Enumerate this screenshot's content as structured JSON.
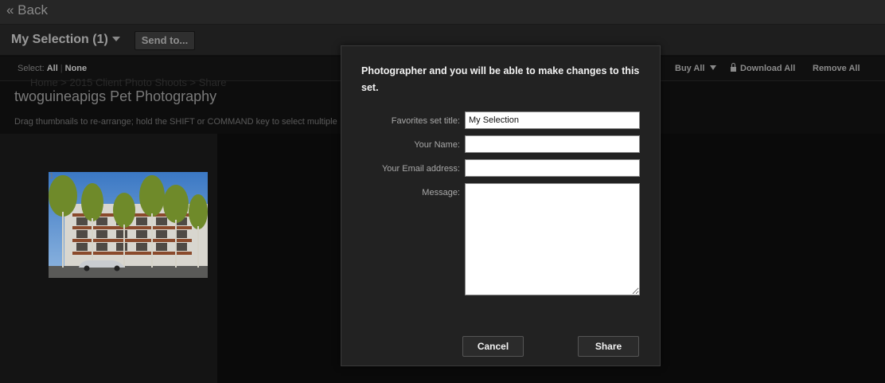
{
  "nav": {
    "back_label": "« Back"
  },
  "selection_bar": {
    "title": "My Selection (1)",
    "send_button_label": "Send to..."
  },
  "toolbar": {
    "select_prefix": "Select:",
    "select_all": "All",
    "select_separator": "|",
    "select_none": "None",
    "buy_all": "Buy All",
    "download_all": "Download All",
    "remove_all": "Remove All"
  },
  "gallery": {
    "breadcrumb": "Home > 2015 Client Photo Shoots > Share",
    "title": "twoguineapigs Pet Photography",
    "hint": "Drag thumbnails to re-arrange; hold the SHIFT or COMMAND key to select multiple",
    "thumbnails": [
      {
        "index": "1"
      }
    ]
  },
  "dialog": {
    "message": "Photographer and you will be able to make changes to this set.",
    "fields": {
      "title_label": "Favorites set title:",
      "title_value": "My Selection",
      "name_label": "Your Name:",
      "name_value": "",
      "email_label": "Your Email address:",
      "email_value": "",
      "message_label": "Message:",
      "message_value": ""
    },
    "cancel_label": "Cancel",
    "share_label": "Share"
  },
  "colors": {
    "topbar": "#262626",
    "dialog_bg": "#222222",
    "background": "#0d0d0d"
  }
}
